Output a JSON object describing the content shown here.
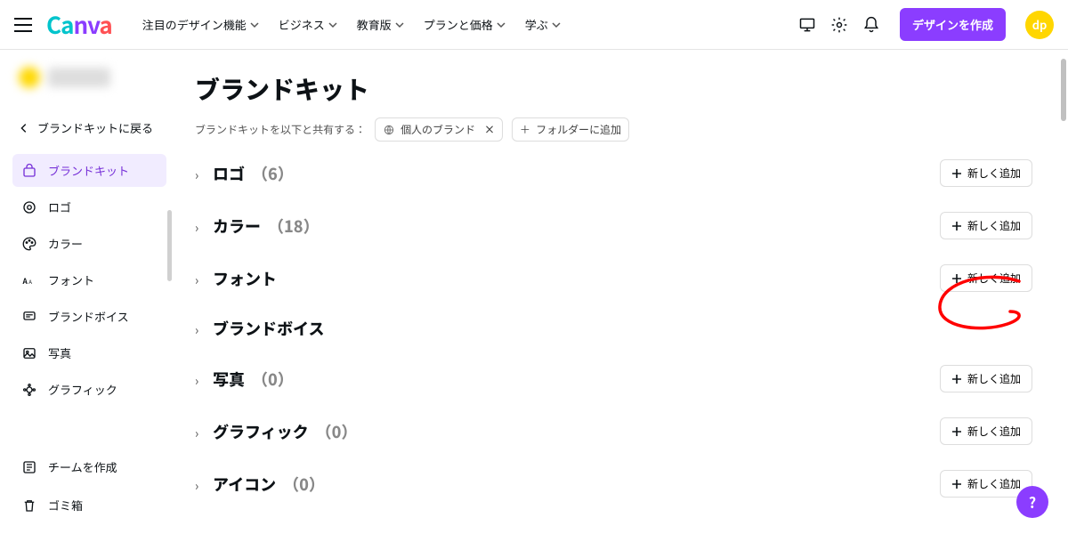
{
  "header": {
    "nav": [
      {
        "label": "注目のデザイン機能"
      },
      {
        "label": "ビジネス"
      },
      {
        "label": "教育版"
      },
      {
        "label": "プランと価格"
      },
      {
        "label": "学ぶ"
      }
    ],
    "create_button": "デザインを作成",
    "avatar_initials": "dp"
  },
  "sidebar": {
    "back_label": "ブランドキットに戻る",
    "items": [
      {
        "icon": "brandkit",
        "label": "ブランドキット",
        "active": true
      },
      {
        "icon": "logo",
        "label": "ロゴ"
      },
      {
        "icon": "color",
        "label": "カラー"
      },
      {
        "icon": "font",
        "label": "フォント"
      },
      {
        "icon": "voice",
        "label": "ブランドボイス"
      },
      {
        "icon": "photo",
        "label": "写真"
      },
      {
        "icon": "graphic",
        "label": "グラフィック"
      }
    ],
    "create_team": "チームを作成",
    "trash": "ゴミ箱"
  },
  "main": {
    "title": "ブランドキット",
    "share_label": "ブランドキットを以下と共有する：",
    "share_chip": "個人のブランド",
    "add_folder": "フォルダーに追加",
    "sections": [
      {
        "title": "ロゴ",
        "count": "（6）",
        "has_add": true
      },
      {
        "title": "カラー",
        "count": "（18）",
        "has_add": true
      },
      {
        "title": "フォント",
        "count": "",
        "has_add": true,
        "highlighted": true
      },
      {
        "title": "ブランドボイス",
        "count": "",
        "has_add": false
      },
      {
        "title": "写真",
        "count": "（0）",
        "has_add": true
      },
      {
        "title": "グラフィック",
        "count": "（0）",
        "has_add": true
      },
      {
        "title": "アイコン",
        "count": "（0）",
        "has_add": true
      }
    ],
    "add_button_label": "新しく追加"
  },
  "help_fab": "?"
}
